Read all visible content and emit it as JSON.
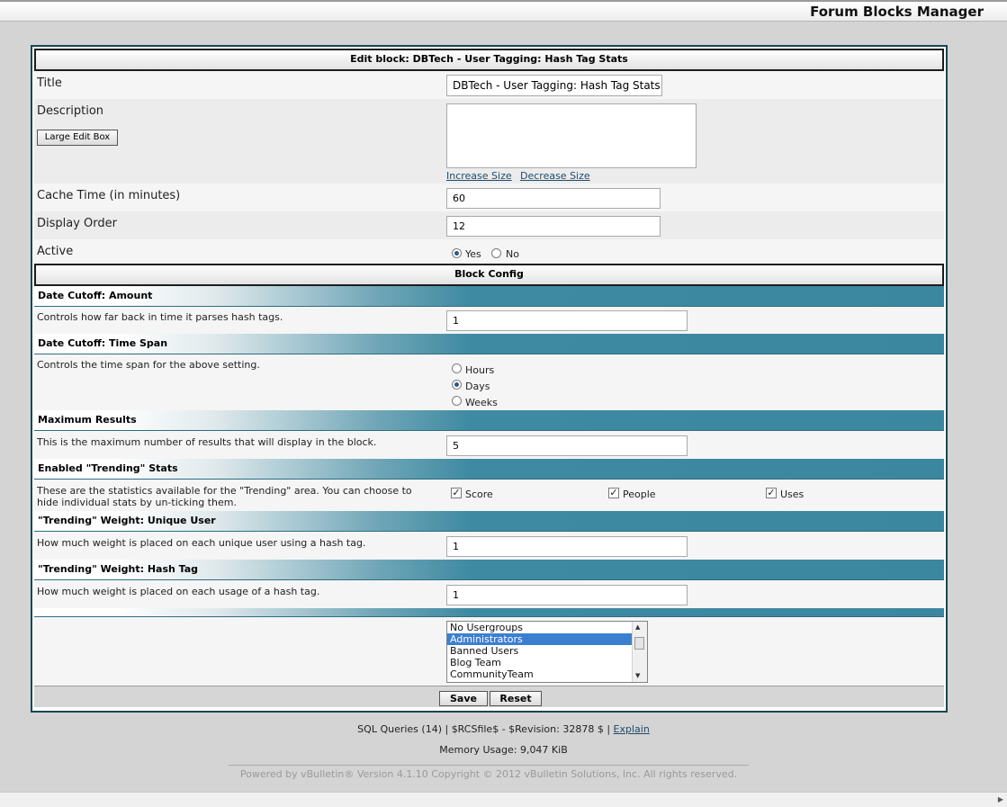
{
  "page_title": "Forum Blocks Manager",
  "edit_header": "Edit block: DBTech - User Tagging: Hash Tag Stats",
  "fields": {
    "title_label": "Title",
    "title_value": "DBTech - User Tagging: Hash Tag Stats",
    "description_label": "Description",
    "large_edit_label": "Large Edit Box",
    "description_value": "",
    "increase_size": "Increase Size",
    "decrease_size": "Decrease Size",
    "cache_label": "Cache Time (in minutes)",
    "cache_value": "60",
    "order_label": "Display Order",
    "order_value": "12",
    "active_label": "Active",
    "active_yes": "Yes",
    "active_no": "No",
    "active_selected": "Yes"
  },
  "block_config_header": "Block Config",
  "config": {
    "date_amount": {
      "heading": "Date Cutoff: Amount",
      "description": "Controls how far back in time it parses hash tags.",
      "value": "1"
    },
    "time_span": {
      "heading": "Date Cutoff: Time Span",
      "description": "Controls the time span for the above setting.",
      "options": [
        "Hours",
        "Days",
        "Weeks"
      ],
      "selected": "Days"
    },
    "max_results": {
      "heading": "Maximum Results",
      "description": "This is the maximum number of results that will display in the block.",
      "value": "5"
    },
    "trending": {
      "heading": "Enabled \"Trending\" Stats",
      "description_line1": "These are the statistics available for the \"Trending\" area. You can choose to",
      "description_line2": "hide individual stats by un-ticking them.",
      "options": [
        "Score",
        "People",
        "Uses"
      ],
      "checked": [
        true,
        true,
        true
      ]
    },
    "weight_user": {
      "heading": "\"Trending\" Weight: Unique User",
      "description": "How much weight is placed on each unique user using a hash tag.",
      "value": "1"
    },
    "weight_tag": {
      "heading": "\"Trending\" Weight: Hash Tag",
      "description": "How much weight is placed on each usage of a hash tag.",
      "value": "1"
    }
  },
  "usergroups": {
    "items": [
      "No Usergroups",
      "Administrators",
      "Banned Users",
      "Blog Team",
      "CommunityTeam"
    ],
    "selected": "Administrators"
  },
  "buttons": {
    "save": "Save",
    "reset": "Reset"
  },
  "footer": {
    "queries_text": "SQL Queries (14) | $RCSfile$ - $Revision: 32878 $ |",
    "explain": "Explain",
    "memory": "Memory Usage: 9,047 KiB",
    "copyright": "Powered by vBulletin® Version 4.1.10 Copyright © 2012 vBulletin Solutions, Inc. All rights reserved."
  },
  "colors": {
    "frame_border": "#174654",
    "category_teal": "#3c87a0",
    "link": "#1d4a6b",
    "selection": "#3b7fd2"
  }
}
